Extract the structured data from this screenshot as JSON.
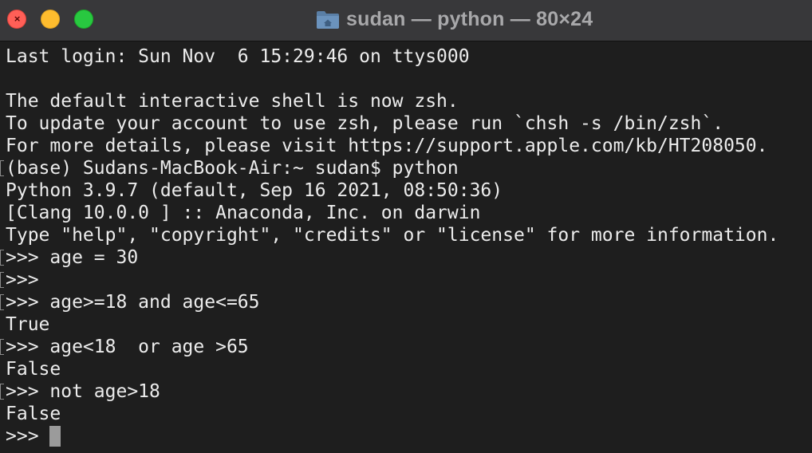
{
  "window": {
    "title": "sudan — python — 80×24"
  },
  "terminal": {
    "lines": [
      {
        "text": "Last login: Sun Nov  6 15:29:46 on ttys000",
        "marked": false
      },
      {
        "text": "",
        "marked": false
      },
      {
        "text": "The default interactive shell is now zsh.",
        "marked": false
      },
      {
        "text": "To update your account to use zsh, please run `chsh -s /bin/zsh`.",
        "marked": false
      },
      {
        "text": "For more details, please visit https://support.apple.com/kb/HT208050.",
        "marked": false
      },
      {
        "text": "(base) Sudans-MacBook-Air:~ sudan$ python",
        "marked": true
      },
      {
        "text": "Python 3.9.7 (default, Sep 16 2021, 08:50:36)",
        "marked": false
      },
      {
        "text": "[Clang 10.0.0 ] :: Anaconda, Inc. on darwin",
        "marked": false
      },
      {
        "text": "Type \"help\", \"copyright\", \"credits\" or \"license\" for more information.",
        "marked": false
      },
      {
        "text": ">>> age = 30",
        "marked": true
      },
      {
        "text": ">>>",
        "marked": true
      },
      {
        "text": ">>> age>=18 and age<=65",
        "marked": true
      },
      {
        "text": "True",
        "marked": false
      },
      {
        "text": ">>> age<18  or age >65",
        "marked": true
      },
      {
        "text": "False",
        "marked": false
      },
      {
        "text": ">>> not age>18",
        "marked": true
      },
      {
        "text": "False",
        "marked": false
      }
    ],
    "prompt": ">>> "
  },
  "colors": {
    "background": "#1e1e1e",
    "titlebar": "#38383a",
    "text": "#ececec",
    "cursor": "#9b9b9b",
    "close": "#ff5f57",
    "minimize": "#febc2e",
    "zoom": "#28c840"
  }
}
